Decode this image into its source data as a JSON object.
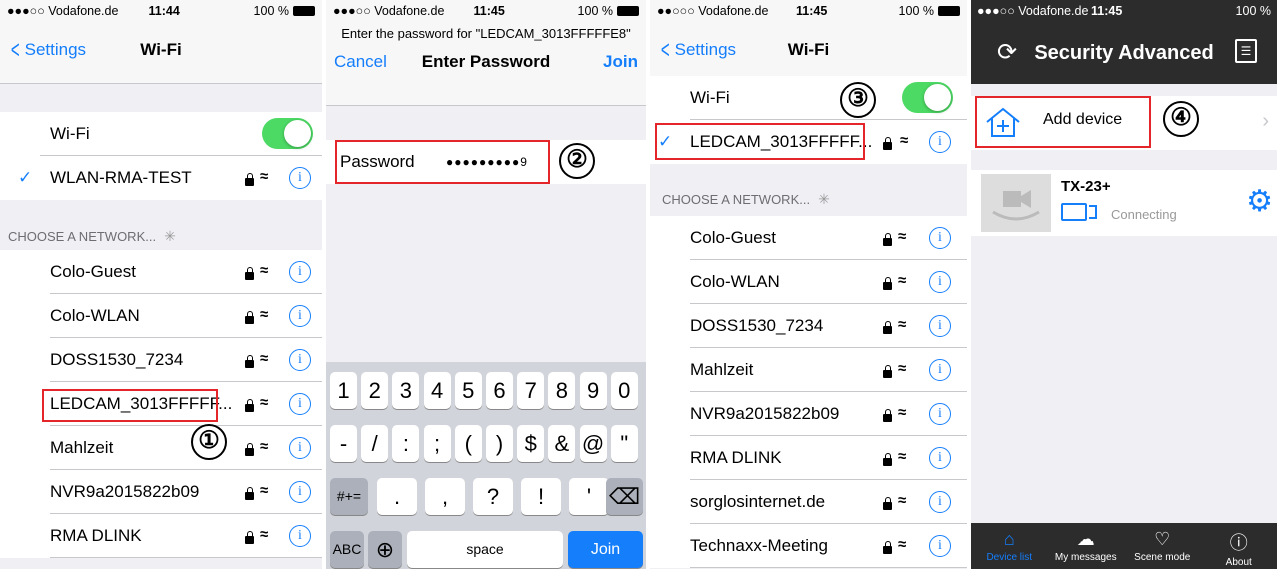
{
  "p1": {
    "status": {
      "carrier": "●●●○○ Vodafone.de",
      "time": "11:44",
      "battery": "100 %"
    },
    "back": "Settings",
    "title": "Wi-Fi",
    "wifi_label": "Wi-Fi",
    "connected": "WLAN-RMA-TEST",
    "section": "CHOOSE A NETWORK...",
    "networks": [
      "Colo-Guest",
      "Colo-WLAN",
      "DOSS1530_7234",
      "LEDCAM_3013FFFFF...",
      "Mahlzeit",
      "NVR9a2015822b09",
      "RMA DLINK"
    ],
    "step": "①"
  },
  "p2": {
    "status": {
      "carrier": "●●●○○ Vodafone.de",
      "time": "11:45",
      "battery": "100 %"
    },
    "prompt": "Enter the password for \"LEDCAM_3013FFFFFE8\"",
    "cancel": "Cancel",
    "title": "Enter Password",
    "join": "Join",
    "pw_label": "Password",
    "pw_value": "●●●●●●●●●9",
    "step": "②",
    "keys_row1": [
      "1",
      "2",
      "3",
      "4",
      "5",
      "6",
      "7",
      "8",
      "9",
      "0"
    ],
    "keys_row2": [
      "-",
      "/",
      ":",
      ";",
      "(",
      ")",
      "$",
      "&",
      "@",
      "\""
    ],
    "keys_row3": [
      "#+=",
      ".",
      ",",
      "?",
      "!",
      "'",
      "⌫"
    ],
    "keys_row4": [
      "ABC",
      "⊕",
      "space",
      "Join"
    ]
  },
  "p3": {
    "status": {
      "carrier": "●●○○○ Vodafone.de",
      "time": "11:45",
      "battery": "100 %"
    },
    "back": "Settings",
    "title": "Wi-Fi",
    "wifi_label": "Wi-Fi",
    "connected": "LEDCAM_3013FFFFF...",
    "section": "CHOOSE A NETWORK...",
    "networks": [
      "Colo-Guest",
      "Colo-WLAN",
      "DOSS1530_7234",
      "Mahlzeit",
      "NVR9a2015822b09",
      "RMA DLINK",
      "sorglosinternet.de",
      "Technaxx-Meeting"
    ],
    "step": "③"
  },
  "p4": {
    "status": {
      "carrier": "●●●○○ Vodafone.de",
      "time": "11:45",
      "battery": "100 %"
    },
    "title": "Security Advanced",
    "add_device": "Add device",
    "device_name": "TX-23+",
    "device_status": "Connecting",
    "step": "④",
    "tabs": [
      "Device list",
      "My messages",
      "Scene mode",
      "About"
    ],
    "accent": "#147efb"
  }
}
